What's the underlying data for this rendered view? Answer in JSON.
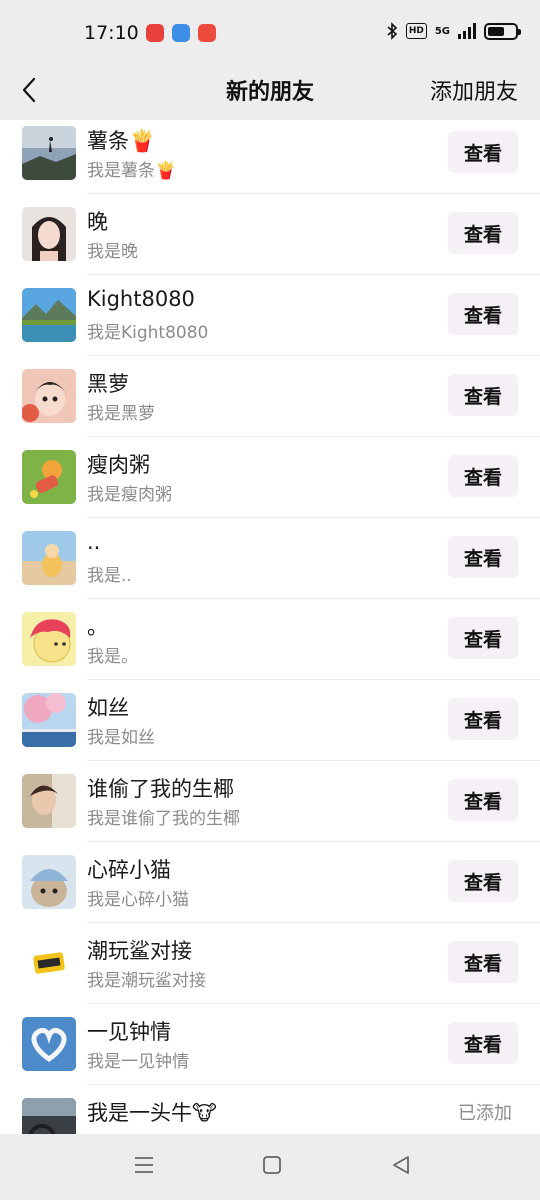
{
  "status": {
    "time": "17:10",
    "hd": "HD",
    "network": "5G",
    "battery_level": 0.6
  },
  "header": {
    "title": "新的朋友",
    "action": "添加朋友"
  },
  "requests": [
    {
      "name": "薯条🍟",
      "message": "我是薯条🍟",
      "button": "查看",
      "avatar": "mountain-silhouette"
    },
    {
      "name": "晚",
      "message": "我是晚",
      "button": "查看",
      "avatar": "girl-portrait"
    },
    {
      "name": "Kight8080",
      "message": "我是Kight8080",
      "button": "查看",
      "avatar": "lake-landscape"
    },
    {
      "name": "黑萝",
      "message": "我是黑萝",
      "button": "查看",
      "avatar": "child-portrait"
    },
    {
      "name": "瘦肉粥",
      "message": "我是瘦肉粥",
      "button": "查看",
      "avatar": "cartoon-on-grass"
    },
    {
      "name": "..",
      "message": "我是..",
      "button": "查看",
      "avatar": "cat-on-beach"
    },
    {
      "name": "。",
      "message": "我是。",
      "button": "查看",
      "avatar": "cartoon-boy-pink-hair"
    },
    {
      "name": "如丝",
      "message": "我是如丝",
      "button": "查看",
      "avatar": "sakura-landscape"
    },
    {
      "name": "谁偷了我的生椰",
      "message": "我是谁偷了我的生椰",
      "button": "查看",
      "avatar": "person-photo"
    },
    {
      "name": "心碎小猫",
      "message": "我是心碎小猫",
      "button": "查看",
      "avatar": "cat-with-hat"
    },
    {
      "name": "潮玩鲨对接",
      "message": "我是潮玩鲨对接",
      "button": "查看",
      "avatar": "brand-logo"
    },
    {
      "name": "一见钟情",
      "message": "我是一见钟情",
      "button": "查看",
      "avatar": "heart-cloud"
    },
    {
      "name": "我是一头牛🐮",
      "message": "",
      "status": "已添加",
      "avatar": "car-interior"
    }
  ],
  "colors": {
    "bar_bg": "#ededed",
    "button_bg": "#f4f0f5",
    "secondary_text": "#8c8c8c"
  }
}
